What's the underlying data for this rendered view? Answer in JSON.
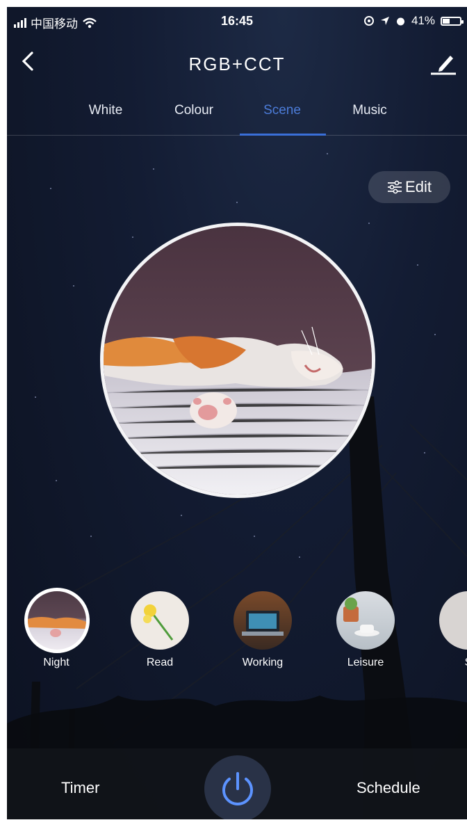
{
  "status_bar": {
    "carrier": "中国移动",
    "time": "16:45",
    "battery_percent": "41%",
    "battery_level": 0.41
  },
  "nav": {
    "title": "RGB+CCT"
  },
  "tabs": [
    {
      "label": "White"
    },
    {
      "label": "Colour"
    },
    {
      "label": "Scene"
    },
    {
      "label": "Music"
    }
  ],
  "active_tab": "Scene",
  "edit_button": {
    "label": "Edit"
  },
  "scenes": [
    {
      "label": "Night",
      "selected": true
    },
    {
      "label": "Read",
      "selected": false
    },
    {
      "label": "Working",
      "selected": false
    },
    {
      "label": "Leisure",
      "selected": false
    },
    {
      "label": "S",
      "selected": false
    }
  ],
  "bottom": {
    "timer_label": "Timer",
    "schedule_label": "Schedule"
  },
  "colors": {
    "accent": "#3a6fd8",
    "active_tab": "#4c7cd9",
    "background": "#131c33"
  },
  "icons": {
    "back": "chevron-left-icon",
    "edit_pen": "pen-icon",
    "edit": "sliders-icon",
    "power": "power-icon"
  }
}
